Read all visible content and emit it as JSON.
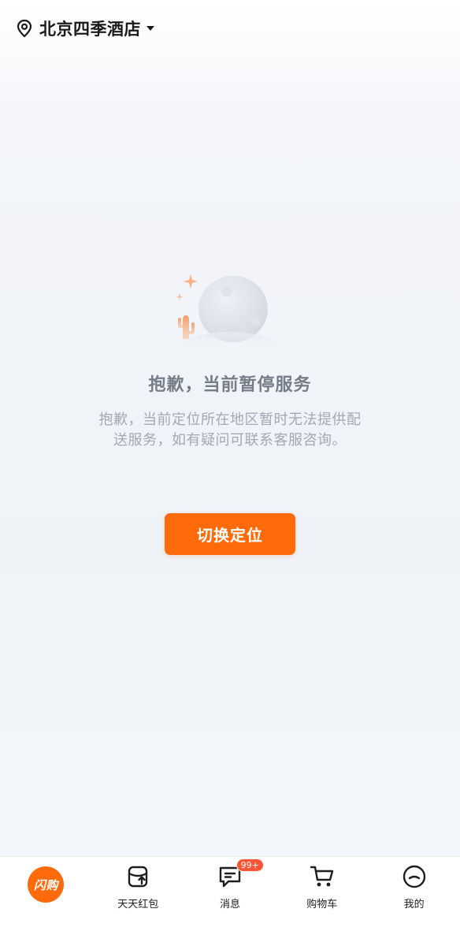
{
  "header": {
    "location_label": "北京四季酒店",
    "location_icon": "location-pin-icon",
    "caret_icon": "caret-down-icon"
  },
  "empty_state": {
    "illustration": "moon-cactus-illustration",
    "title": "抱歉，当前暂停服务",
    "description": "抱歉，当前定位所在地区暂时无法提供配送服务，如有疑问可联系客服咨询。",
    "button_label": "切换定位"
  },
  "tabbar": {
    "items": [
      {
        "label": "闪购",
        "icon": "shangou-logo",
        "active": true
      },
      {
        "label": "天天红包",
        "icon": "red-packet-icon"
      },
      {
        "label": "消息",
        "icon": "message-icon",
        "badge": "99+"
      },
      {
        "label": "购物车",
        "icon": "cart-icon"
      },
      {
        "label": "我的",
        "icon": "profile-icon"
      }
    ]
  },
  "colors": {
    "accent": "#ff6a0a",
    "badge": "#ff5436",
    "title_text": "#757d89",
    "desc_text": "#a3a9b2"
  }
}
